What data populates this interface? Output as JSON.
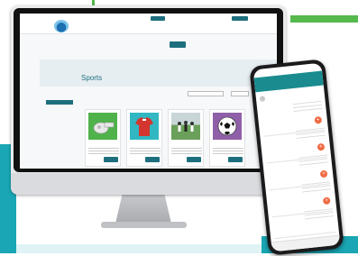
{
  "colors": {
    "accent": "#1d6f7e",
    "phone_header": "#1a8c8f",
    "brand_green": "#55b94e",
    "cta_orange": "#ef6b45"
  },
  "site": {
    "brand_name": "",
    "utility": {
      "btn_cart": "",
      "links": [
        "",
        "",
        ""
      ],
      "btn_account": ""
    },
    "nav": [
      "",
      "",
      "",
      "",
      "",
      "",
      ""
    ],
    "nav_active_index": 4,
    "breadcrumb": "",
    "page_title": "Sports",
    "sidebar": {
      "heading": "",
      "items": [
        "",
        "",
        "",
        "",
        "",
        ""
      ],
      "active_index": 0
    },
    "search_placeholder": "",
    "sort_labels": [
      "",
      ""
    ],
    "section_label": "",
    "products": [
      {
        "name": "",
        "price": "",
        "button": "",
        "icon": "whistle-icon"
      },
      {
        "name": "",
        "price": "",
        "button": "",
        "icon": "jersey-icon"
      },
      {
        "name": "",
        "price": "",
        "button": "",
        "icon": "team-photo-icon"
      },
      {
        "name": "",
        "price": "",
        "button": "",
        "icon": "soccer-ball-icon"
      }
    ]
  },
  "phone": {
    "status_time": "",
    "header_title": "",
    "header_sub": "",
    "user_name": "",
    "items": [
      {
        "title": "",
        "price": ""
      },
      {
        "title": "",
        "price": ""
      },
      {
        "title": "",
        "price": ""
      },
      {
        "title": "",
        "price": ""
      },
      {
        "title": "",
        "price": ""
      }
    ]
  }
}
